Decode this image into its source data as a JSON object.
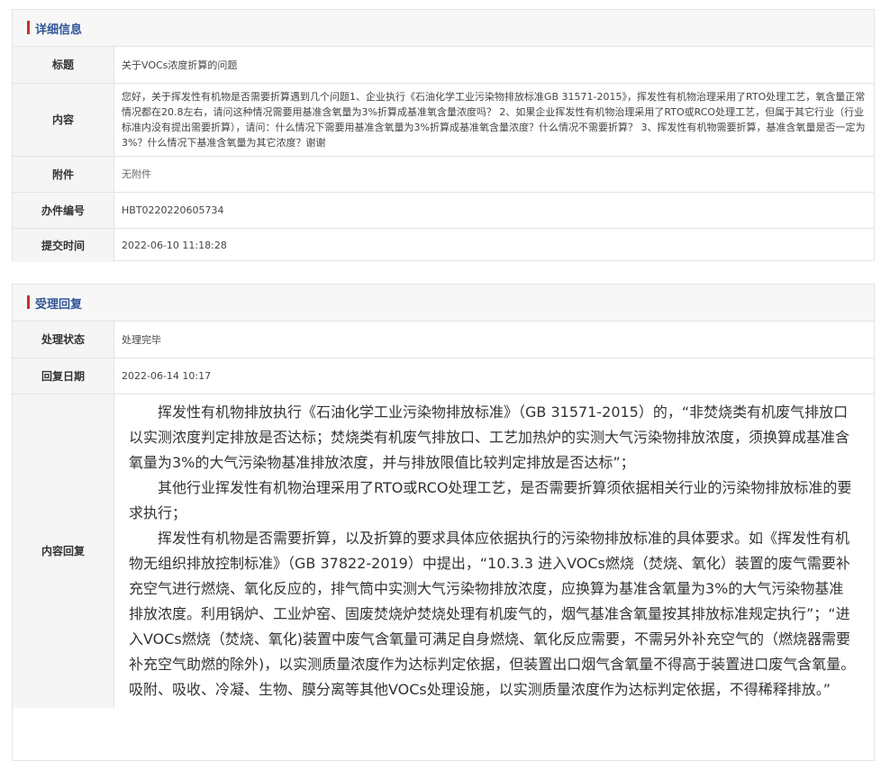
{
  "detail": {
    "header": "详细信息",
    "title_label": "标题",
    "title_value": "关于VOCs浓度折算的问题",
    "content_label": "内容",
    "content_value": "您好，关于挥发性有机物是否需要折算遇到几个问题1、企业执行《石油化学工业污染物排放标准GB 31571-2015》，挥发性有机物治理采用了RTO处理工艺，氧含量正常情况都在20.8左右，请问这种情况需要用基准含氧量为3%折算成基准氧含量浓度吗？ 2、如果企业挥发性有机物治理采用了RTO或RCO处理工艺，但属于其它行业（行业标准内没有提出需要折算），请问：什么情况下需要用基准含氧量为3%折算成基准氧含量浓度？什么情况不需要折算？ 3、挥发性有机物需要折算，基准含氧量是否一定为3%？什么情况下基准含氧量为其它浓度？谢谢",
    "attachment_label": "附件",
    "attachment_value": "无附件",
    "case_no_label": "办件编号",
    "case_no_value": "HBT0220220605734",
    "submit_time_label": "提交时间",
    "submit_time_value": "2022-06-10 11:18:28"
  },
  "reply": {
    "header": "受理回复",
    "status_label": "处理状态",
    "status_value": "处理完毕",
    "date_label": "回复日期",
    "date_value": "2022-06-14 10:17",
    "content_label": "内容回复",
    "paragraphs": [
      "挥发性有机物排放执行《石油化学工业污染物排放标准》（GB 31571-2015）的，“非焚烧类有机废气排放口以实测浓度判定排放是否达标；焚烧类有机废气排放口、工艺加热炉的实测大气污染物排放浓度，须换算成基准含氧量为3%的大气污染物基准排放浓度，并与排放限值比较判定排放是否达标”；",
      "其他行业挥发性有机物治理采用了RTO或RCO处理工艺，是否需要折算须依据相关行业的污染物排放标准的要求执行；",
      "挥发性有机物是否需要折算，以及折算的要求具体应依据执行的污染物排放标准的具体要求。如《挥发性有机物无组织排放控制标准》（GB 37822-2019）中提出，“10.3.3 进入VOCs燃烧（焚烧、氧化）装置的废气需要补充空气进行燃烧、氧化反应的，排气筒中实测大气污染物排放浓度，应换算为基准含氧量为3%的大气污染物基准排放浓度。利用锅炉、工业炉窑、固废焚烧炉焚烧处理有机废气的，烟气基准含氧量按其排放标准规定执行”；“进入VOCs燃烧（焚烧、氧化)装置中废气含氧量可满足自身燃烧、氧化反应需要，不需另外补充空气的（燃烧器需要补充空气助燃的除外)，以实测质量浓度作为达标判定依据，但装置出口烟气含氧量不得高于装置进口废气含氧量。吸附、吸收、冷凝、生物、膜分离等其他VOCs处理设施，以实测质量浓度作为达标判定依据，不得稀释排放。”"
    ]
  },
  "colors": {
    "accent_bar": "#c9302c",
    "header_text": "#2f5597",
    "label_bg": "#f5f5f5",
    "border": "#e4e4e4"
  }
}
